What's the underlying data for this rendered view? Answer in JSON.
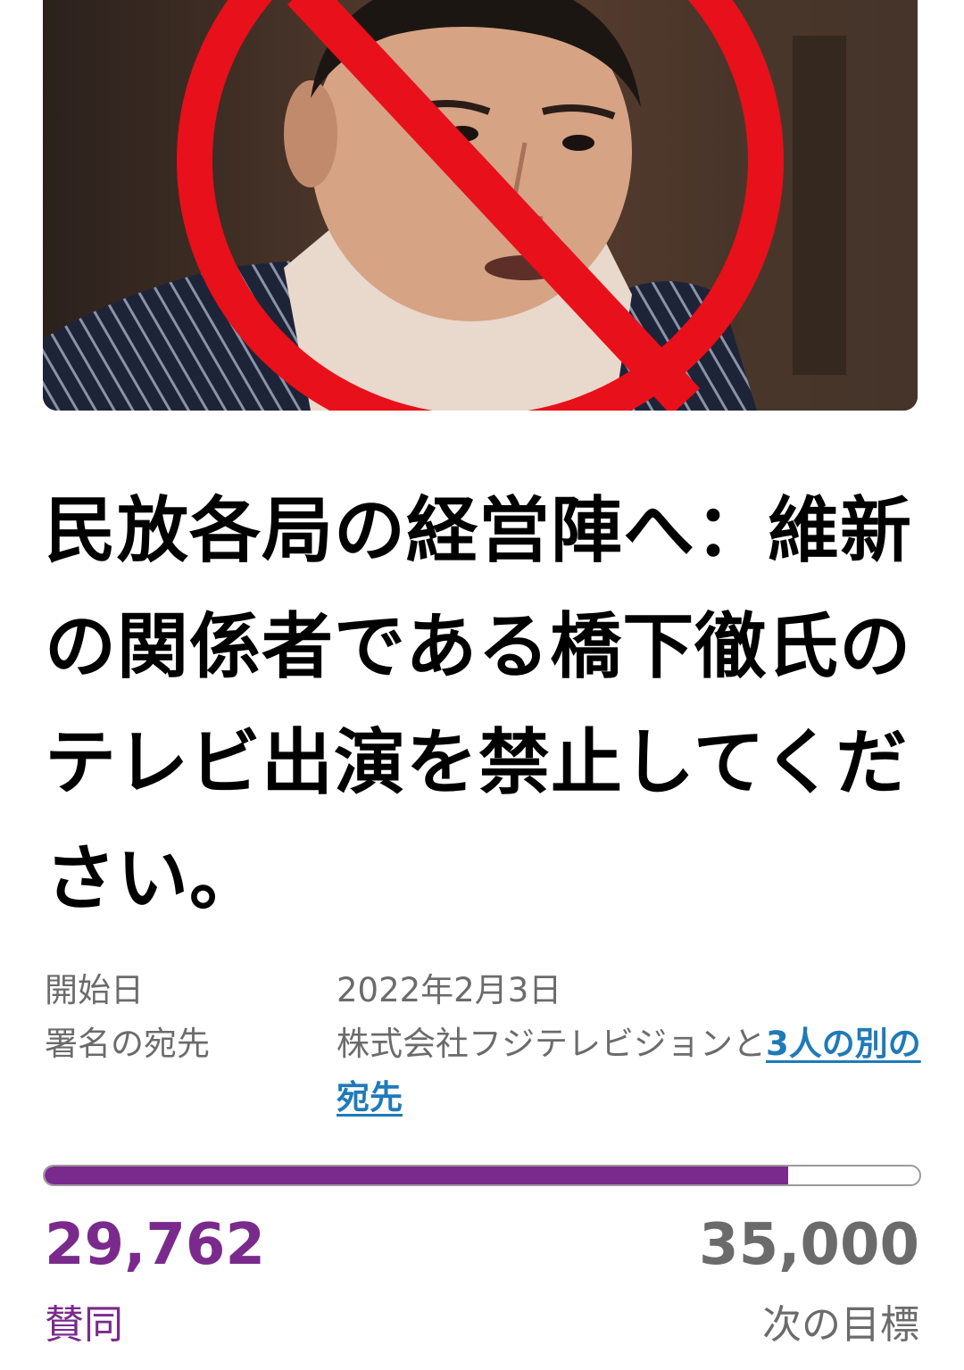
{
  "petition": {
    "title": "民放各局の経営陣へ：維新の関係者である橋下徹氏のテレビ出演を禁止してください。",
    "meta": {
      "start_label": "開始日",
      "start_value": "2022年2月3日",
      "recipient_label": "署名の宛先",
      "recipient_value": "株式会社フジテレビジョンと",
      "recipient_link": "3人の別の宛先"
    },
    "progress": {
      "signatures": "29,762",
      "signatures_label": "賛同",
      "goal": "35,000",
      "goal_label": "次の目標",
      "fraction": 0.85
    }
  },
  "colors": {
    "accent": "#7a2a8c",
    "link": "#1f7ab8",
    "muted": "#6b6b6b",
    "prohibition": "#e8101a"
  }
}
